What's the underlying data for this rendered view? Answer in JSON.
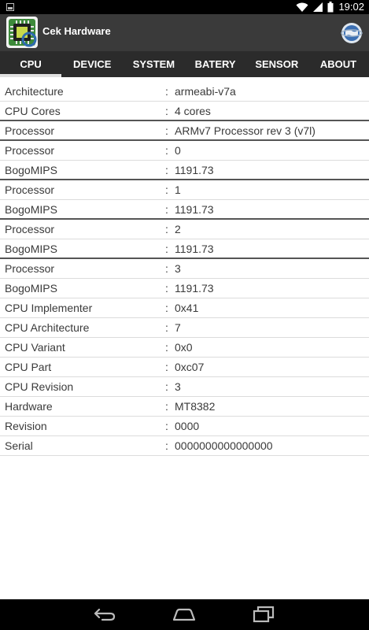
{
  "status": {
    "time": "19:02"
  },
  "app": {
    "title": "Cek Hardware"
  },
  "tabs": [
    "CPU",
    "DEVICE",
    "SYSTEM",
    "BATERY",
    "SENSOR",
    "ABOUT"
  ],
  "rows": [
    {
      "label": "Architecture",
      "value": "armeabi-v7a"
    },
    {
      "label": "CPU Cores",
      "value": "4 cores"
    },
    {
      "label": "Processor",
      "value": "ARMv7 Processor rev 3 (v7l)"
    },
    {
      "label": "Processor",
      "value": "0"
    },
    {
      "label": "BogoMIPS",
      "value": "1191.73"
    },
    {
      "label": "Processor",
      "value": "1"
    },
    {
      "label": "BogoMIPS",
      "value": "1191.73"
    },
    {
      "label": "Processor",
      "value": "2"
    },
    {
      "label": "BogoMIPS",
      "value": "1191.73"
    },
    {
      "label": "Processor",
      "value": "3"
    },
    {
      "label": "BogoMIPS",
      "value": "1191.73"
    },
    {
      "label": "CPU Implementer",
      "value": "0x41"
    },
    {
      "label": "CPU Architecture",
      "value": "7"
    },
    {
      "label": "CPU Variant",
      "value": "0x0"
    },
    {
      "label": "CPU Part",
      "value": "0xc07"
    },
    {
      "label": "CPU Revision",
      "value": "3"
    },
    {
      "label": "Hardware",
      "value": "MT8382"
    },
    {
      "label": "Revision",
      "value": "0000"
    },
    {
      "label": "Serial",
      "value": "0000000000000000"
    }
  ],
  "separator": ":",
  "icons": {
    "status_left": "image-icon",
    "wifi": "wifi-icon",
    "signal": "signal-icon",
    "battery": "battery-icon",
    "app": "cpu-chip-app-icon",
    "action": "globe-icon",
    "nav_back": "back-icon",
    "nav_home": "home-icon",
    "nav_recents": "recents-icon"
  }
}
